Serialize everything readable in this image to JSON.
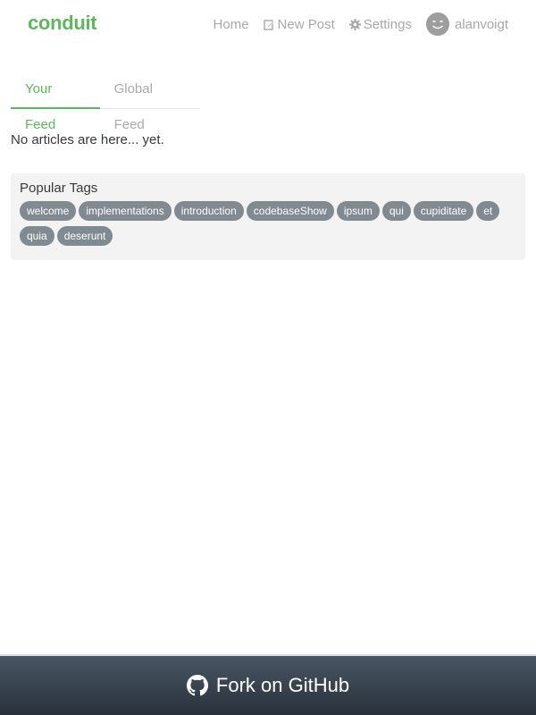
{
  "navbar": {
    "brand": "conduit",
    "links": [
      {
        "label": "Home",
        "icon": null
      },
      {
        "label": "New Post",
        "icon": "edit-icon"
      },
      {
        "label": "Settings",
        "icon": "gear-icon"
      },
      {
        "label": "alanvoigt",
        "icon": "avatar"
      }
    ]
  },
  "feed": {
    "tabs": [
      {
        "label": "Your Feed",
        "active": true
      },
      {
        "label": "Global Feed",
        "active": false
      }
    ],
    "empty_message": "No articles are here... yet."
  },
  "sidebar": {
    "title": "Popular Tags",
    "tags": [
      "welcome",
      "implementations",
      "introduction",
      "codebaseShow",
      "ipsum",
      "qui",
      "cupiditate",
      "et",
      "quia",
      "deserunt"
    ]
  },
  "footer": {
    "label": "Fork on GitHub",
    "icon": "github-icon"
  },
  "colors": {
    "brand": "#5cb85c",
    "tag_bg": "#818a91",
    "sidebar_bg": "#f3f3f3"
  }
}
